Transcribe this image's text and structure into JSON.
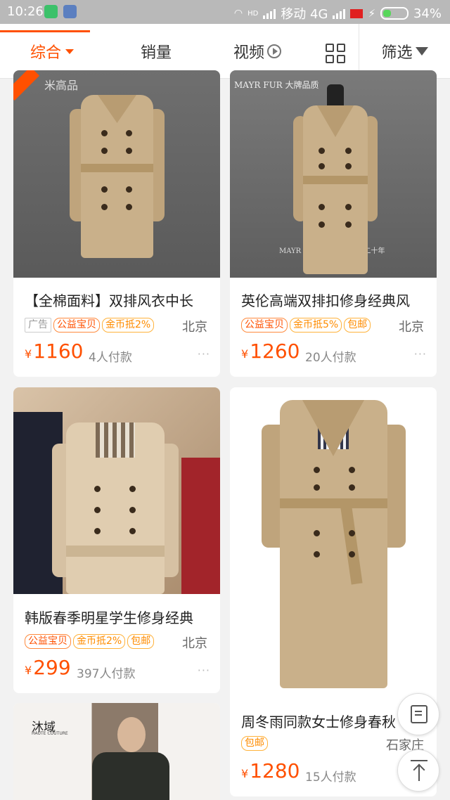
{
  "status_bar": {
    "time": "10:26",
    "network_type": "HD",
    "carrier": "移动 4G",
    "battery": "34%",
    "battery_level": 0.34
  },
  "sort_bar": {
    "tabs": [
      {
        "label": "综合",
        "active": true
      },
      {
        "label": "销量",
        "active": false
      },
      {
        "label": "视频",
        "active": false
      }
    ],
    "filter_label": "筛选",
    "accent_color": "#ff5000"
  },
  "products": [
    {
      "image_text": "米高品",
      "title": "【全棉面料】双排风衣中长",
      "tags": [
        "广告",
        "公益宝贝",
        "金币抵2%"
      ],
      "location": "北京",
      "price_symbol": "¥",
      "price": "1160",
      "sold": "4人付款",
      "more": "···"
    },
    {
      "image_text": "MAYR FUR 大牌品质",
      "image_text_2": "MAYR FUR 专注高端成衣二十年",
      "title": "英伦高端双排扣修身经典风",
      "tags": [
        "公益宝贝",
        "金币抵5%",
        "包邮"
      ],
      "location": "北京",
      "price_symbol": "¥",
      "price": "1260",
      "sold": "20人付款",
      "more": "···"
    },
    {
      "title": "韩版春季明星学生修身经典",
      "tags": [
        "公益宝贝",
        "金币抵2%",
        "包邮"
      ],
      "location": "北京",
      "price_symbol": "¥",
      "price": "299",
      "sold": "397人付款",
      "more": "···"
    },
    {
      "title": "周冬雨同款女士修身春秋",
      "tags": [
        "包邮"
      ],
      "location": "石家庄",
      "price_symbol": "¥",
      "price": "1280",
      "sold": "15人付款",
      "more": "···"
    },
    {
      "image_text": "沐域",
      "image_text_2": "HAUTE COUTURE"
    }
  ]
}
